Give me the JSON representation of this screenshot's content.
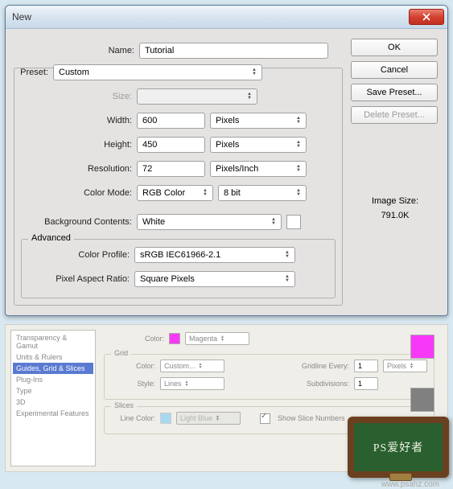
{
  "dialog": {
    "title": "New",
    "labels": {
      "name": "Name:",
      "preset": "Preset:",
      "size": "Size:",
      "width": "Width:",
      "height": "Height:",
      "resolution": "Resolution:",
      "color_mode": "Color Mode:",
      "bg_contents": "Background Contents:",
      "advanced": "Advanced",
      "color_profile": "Color Profile:",
      "pixel_aspect": "Pixel Aspect Ratio:",
      "image_size": "Image Size:"
    },
    "values": {
      "name": "Tutorial",
      "preset": "Custom",
      "size": "",
      "width": "600",
      "width_unit": "Pixels",
      "height": "450",
      "height_unit": "Pixels",
      "resolution": "72",
      "resolution_unit": "Pixels/Inch",
      "color_mode": "RGB Color",
      "color_bits": "8 bit",
      "bg_contents": "White",
      "color_profile": "sRGB IEC61966-2.1",
      "pixel_aspect": "Square Pixels",
      "image_size_value": "791.0K"
    },
    "buttons": {
      "ok": "OK",
      "cancel": "Cancel",
      "save_preset": "Save Preset...",
      "delete_preset": "Delete Preset..."
    }
  },
  "prefs": {
    "sidebar": [
      "Transparency & Gamut",
      "Units & Rulers",
      "Guides, Grid & Slices",
      "Plug-Ins",
      "Type",
      "3D",
      "Experimental Features"
    ],
    "sidebar_selected_index": 2,
    "guides": {
      "color_label": "Color:",
      "color_value": "Magenta",
      "swatch_color": "#f838f8"
    },
    "grid": {
      "title": "Grid",
      "color_label": "Color:",
      "color_value": "Custom...",
      "style_label": "Style:",
      "style_value": "Lines",
      "gridline_label": "Gridline Every:",
      "gridline_value": "1",
      "gridline_unit": "Pixels",
      "subdiv_label": "Subdivisions:",
      "subdiv_value": "1"
    },
    "slices": {
      "title": "Slices",
      "line_color_label": "Line Color:",
      "line_color_value": "Light Blue",
      "show_label": "Show Slice Numbers"
    },
    "chalkboard": "PS爱好者",
    "watermark": "www.psahz.com"
  }
}
